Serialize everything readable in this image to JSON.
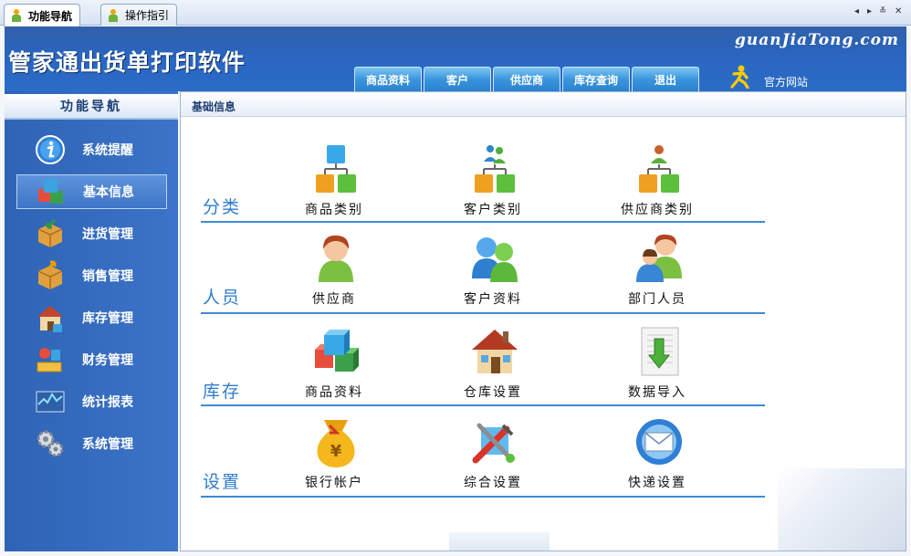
{
  "tabs": [
    {
      "label": "功能导航",
      "active": true
    },
    {
      "label": "操作指引",
      "active": false
    }
  ],
  "tab_controls": [
    "◂",
    "▸",
    "≚",
    "✕"
  ],
  "header": {
    "title": "管家通出货单打印软件",
    "brand": "guanJiaTong.com",
    "nav": [
      "商品资料",
      "客户",
      "供应商",
      "库存查询",
      "退出"
    ],
    "site_link": "官方网站",
    "accent": "#2b6cc6"
  },
  "sidebar": {
    "title": "功能导航",
    "items": [
      {
        "label": "系统提醒",
        "icon": "info-icon"
      },
      {
        "label": "基本信息",
        "icon": "cubes-icon",
        "active": true
      },
      {
        "label": "进货管理",
        "icon": "box-in-icon"
      },
      {
        "label": "销售管理",
        "icon": "box-out-icon"
      },
      {
        "label": "库存管理",
        "icon": "warehouse-icon"
      },
      {
        "label": "财务管理",
        "icon": "finance-icon"
      },
      {
        "label": "统计报表",
        "icon": "chart-icon"
      },
      {
        "label": "系统管理",
        "icon": "gears-icon"
      }
    ]
  },
  "main": {
    "tab_title": "基础信息",
    "sections": [
      {
        "label": "分类",
        "tiles": [
          {
            "label": "商品类别",
            "icon": "category-tree-icon"
          },
          {
            "label": "客户类别",
            "icon": "customer-tree-icon"
          },
          {
            "label": "供应商类别",
            "icon": "supplier-tree-icon"
          }
        ]
      },
      {
        "label": "人员",
        "tiles": [
          {
            "label": "供应商",
            "icon": "supplier-person-icon"
          },
          {
            "label": "客户资料",
            "icon": "customers-icon"
          },
          {
            "label": "部门人员",
            "icon": "staff-icon"
          }
        ]
      },
      {
        "label": "库存",
        "tiles": [
          {
            "label": "商品资料",
            "icon": "cubes-icon"
          },
          {
            "label": "仓库设置",
            "icon": "house-icon"
          },
          {
            "label": "数据导入",
            "icon": "import-icon"
          }
        ]
      },
      {
        "label": "设置",
        "tiles": [
          {
            "label": "银行帐户",
            "icon": "money-bag-icon"
          },
          {
            "label": "综合设置",
            "icon": "tools-icon"
          },
          {
            "label": "快递设置",
            "icon": "mail-icon"
          }
        ]
      }
    ]
  }
}
